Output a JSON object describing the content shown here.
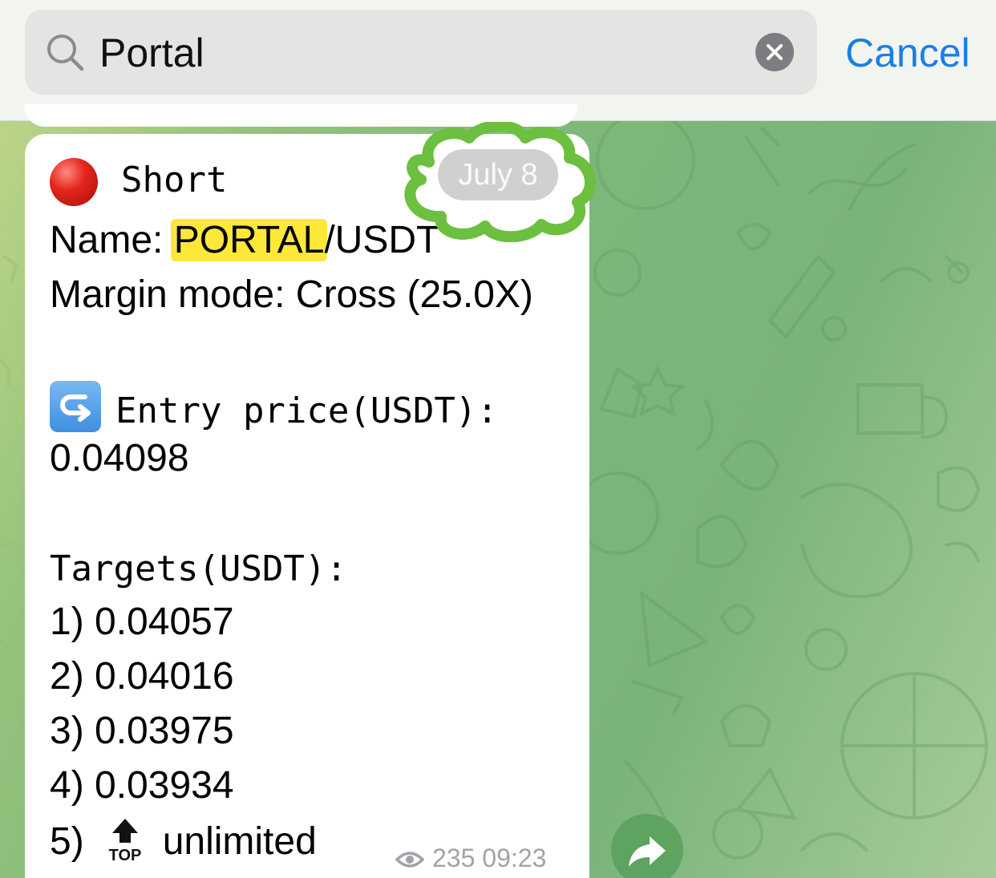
{
  "search": {
    "query": "Portal",
    "clear_icon": "close-circle-icon",
    "cancel_label": "Cancel"
  },
  "date_badge": "July 8",
  "message": {
    "direction_icon": "red-circle-icon",
    "direction": "Short",
    "name_label": "Name: ",
    "name_highlight": "PORTAL",
    "name_rest": "/USDT",
    "margin_label": "Margin mode: Cross (25.0X)",
    "entry_icon": "return-arrow-icon",
    "entry_label": "Entry price(USDT):",
    "entry_value": "0.04098",
    "targets_label": "Targets(USDT):",
    "targets": [
      "1) 0.04057",
      "2) 0.04016",
      "3) 0.03975",
      "4) 0.03934"
    ],
    "target_5_prefix": "5)",
    "target_5_icon": "top-arrow-icon",
    "target_5_value": "unlimited",
    "views": "235",
    "time": "09:23"
  },
  "share_icon": "share-arrow-icon",
  "colors": {
    "accent": "#1a7fe6",
    "highlight": "#fde83a",
    "cloud_outline": "#6cbf3f"
  }
}
